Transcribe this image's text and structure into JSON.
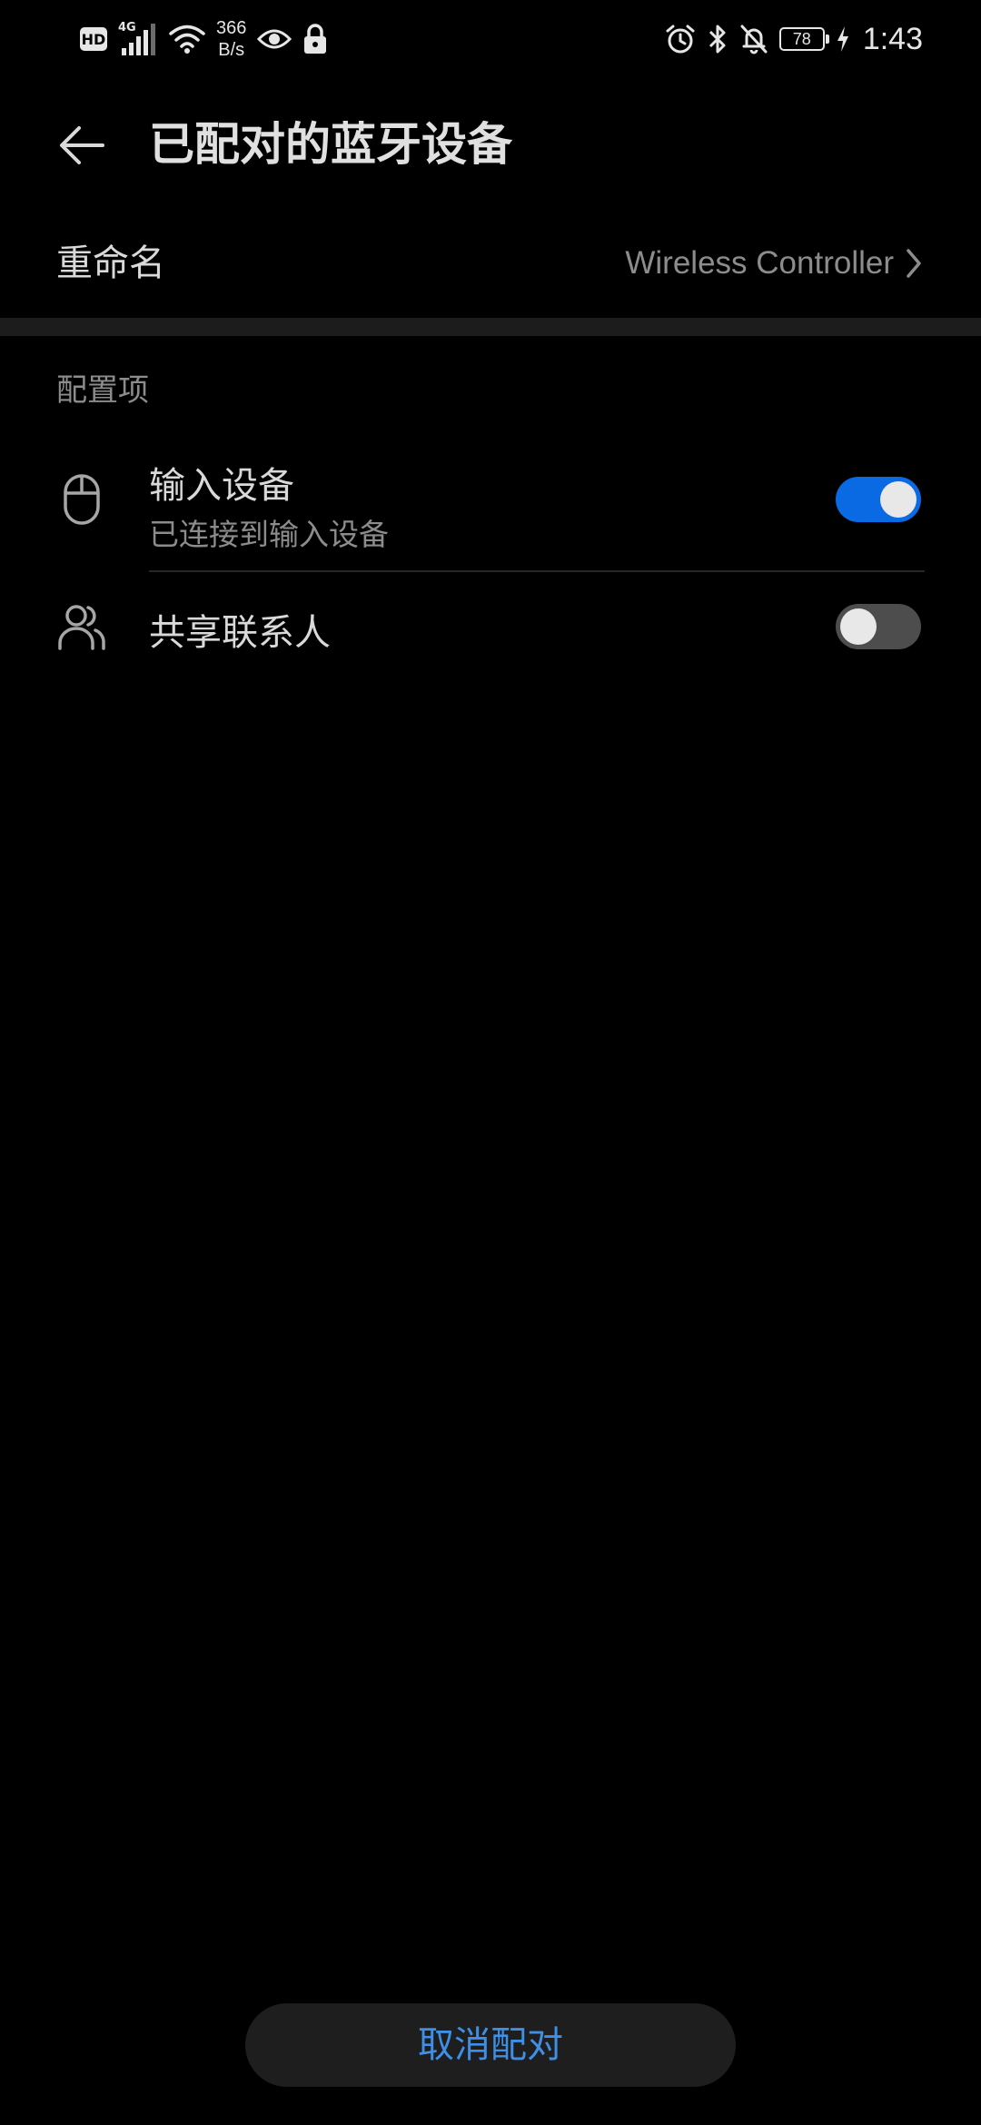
{
  "status_bar": {
    "hd": "HD",
    "network_type": "4G",
    "net_speed_value": "366",
    "net_speed_unit": "B/s",
    "battery_level": "78",
    "time": "1:43",
    "icons": [
      "hd-icon",
      "cellular-signal-icon",
      "wifi-icon",
      "eye-comfort-icon",
      "lock-icon",
      "alarm-icon",
      "bluetooth-icon",
      "silent-bell-icon",
      "battery-icon",
      "charging-icon"
    ]
  },
  "header": {
    "title": "已配对的蓝牙设备",
    "back_icon": "arrow-left-icon"
  },
  "rename": {
    "label": "重命名",
    "value": "Wireless Controller",
    "chevron_icon": "chevron-right-icon"
  },
  "config_section": {
    "header": "配置项",
    "items": [
      {
        "icon": "mouse-icon",
        "title": "输入设备",
        "subtitle": "已连接到输入设备",
        "enabled": true
      },
      {
        "icon": "contacts-icon",
        "title": "共享联系人",
        "enabled": false
      }
    ]
  },
  "footer": {
    "unpair_label": "取消配对"
  },
  "colors": {
    "background": "#000000",
    "accent": "#0a6ae3",
    "button_text": "#3f8fe6",
    "primary_text": "#d9d9d9",
    "secondary_text": "#8c8c8c"
  }
}
